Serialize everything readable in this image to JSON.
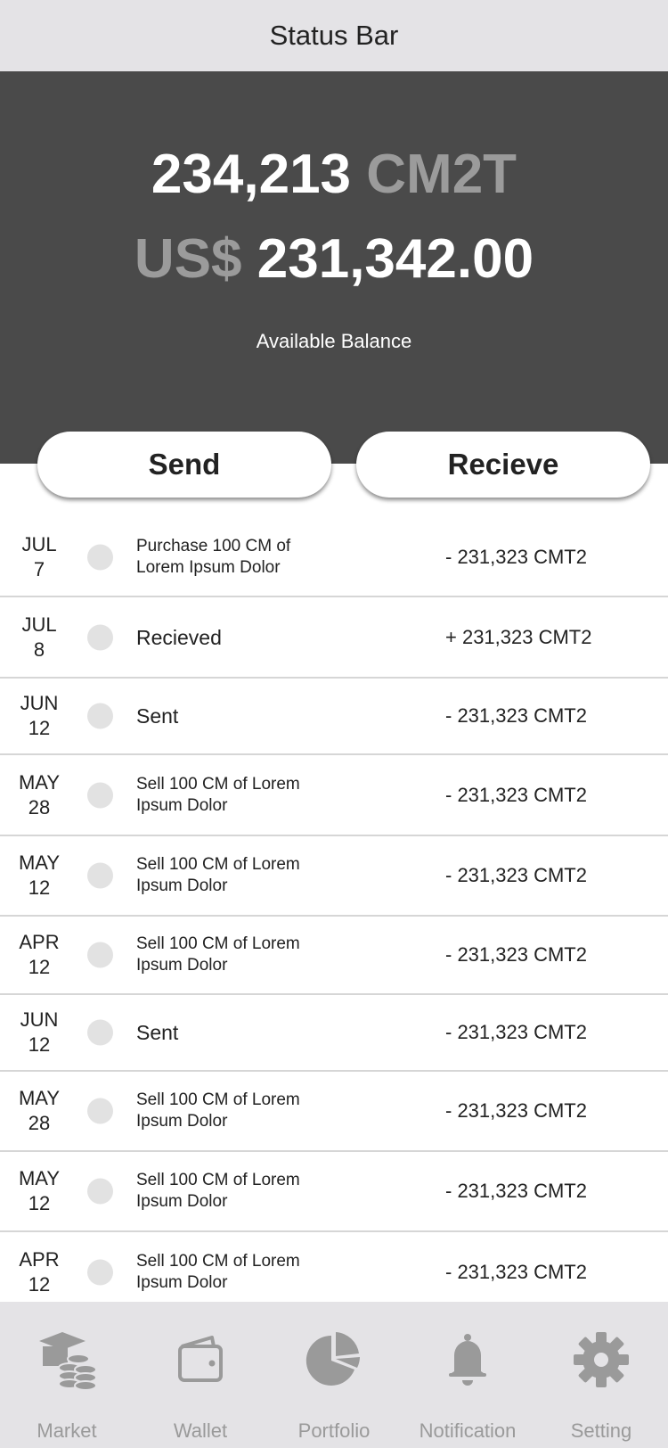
{
  "status_bar": {
    "title": "Status Bar"
  },
  "balance": {
    "token_amount": "234,213",
    "token_symbol": "CM2T",
    "fiat_prefix": "US$",
    "fiat_amount": "231,342.00",
    "label": "Available Balance"
  },
  "actions": {
    "send_label": "Send",
    "receive_label": "Recieve"
  },
  "transactions": [
    {
      "month": "JUL",
      "day": "7",
      "description": "Purchase  100 CM of Lorem Ipsum Dolor",
      "amount": "- 231,323 CMT2"
    },
    {
      "month": "JUL",
      "day": "8",
      "description": "Recieved",
      "amount": "+ 231,323 CMT2"
    },
    {
      "month": "JUN",
      "day": "12",
      "description": "Sent",
      "amount": "- 231,323 CMT2"
    },
    {
      "month": "MAY",
      "day": "28",
      "description": "Sell 100 CM of Lorem Ipsum Dolor",
      "amount": "- 231,323 CMT2"
    },
    {
      "month": "MAY",
      "day": "12",
      "description": "Sell 100 CM of Lorem Ipsum Dolor",
      "amount": "- 231,323 CMT2"
    },
    {
      "month": "APR",
      "day": "12",
      "description": "Sell 100 CM of Lorem Ipsum Dolor",
      "amount": "- 231,323 CMT2"
    },
    {
      "month": "JUN",
      "day": "12",
      "description": "Sent",
      "amount": "- 231,323 CMT2"
    },
    {
      "month": "MAY",
      "day": "28",
      "description": "Sell 100 CM of Lorem Ipsum Dolor",
      "amount": "- 231,323 CMT2"
    },
    {
      "month": "MAY",
      "day": "12",
      "description": "Sell 100 CM of Lorem Ipsum Dolor",
      "amount": "- 231,323 CMT2"
    },
    {
      "month": "APR",
      "day": "12",
      "description": "Sell 100 CM of Lorem Ipsum Dolor",
      "amount": "- 231,323 CMT2"
    }
  ],
  "tab_bar": {
    "items": [
      {
        "label": "Market",
        "icon": "market-icon"
      },
      {
        "label": "Wallet",
        "icon": "wallet-icon"
      },
      {
        "label": "Portfolio",
        "icon": "portfolio-icon"
      },
      {
        "label": "Notification",
        "icon": "bell-icon"
      },
      {
        "label": "Setting",
        "icon": "gear-icon"
      }
    ]
  },
  "colors": {
    "panel_bg": "#4a4a4a",
    "bar_bg": "#e4e3e6",
    "muted_text": "#9b9b9b"
  }
}
